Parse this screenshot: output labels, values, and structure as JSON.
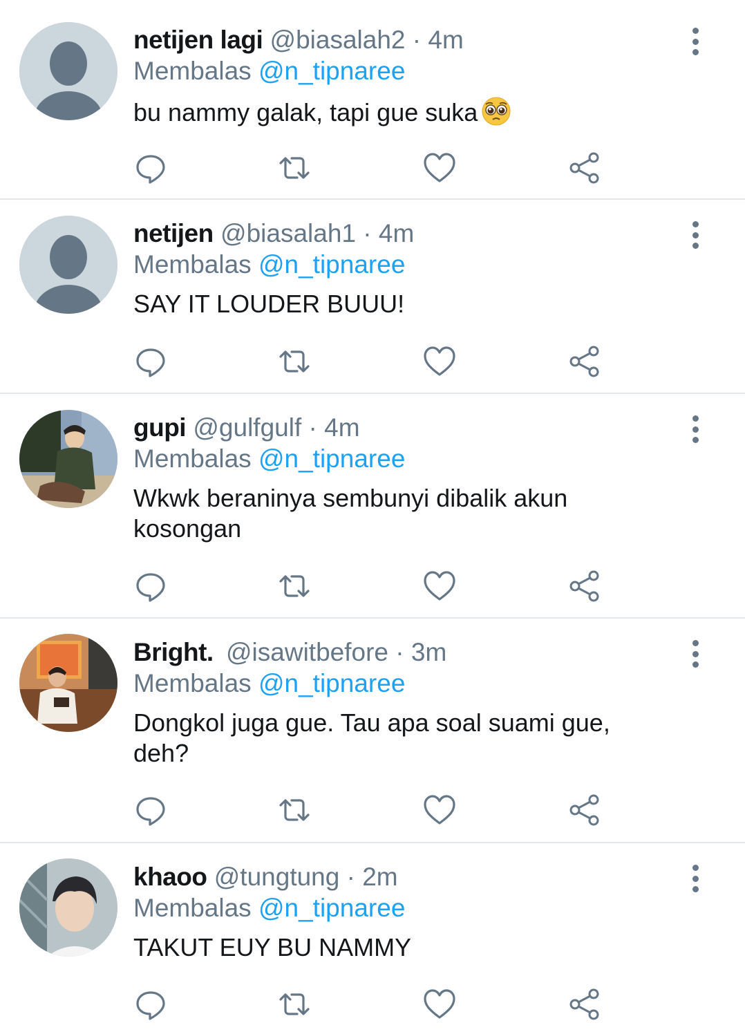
{
  "tweets": [
    {
      "name": "netijen lagi",
      "handle": "@biasalah2",
      "separator": "·",
      "time": "4m",
      "replying_label": "Membalas",
      "replying_to": "@n_tipnaree",
      "text": "bu nammy galak, tapi gue suka",
      "emoji": "pleading-face",
      "avatar": "default-avatar"
    },
    {
      "name": "netijen",
      "handle": "@biasalah1",
      "separator": "·",
      "time": "4m",
      "replying_label": "Membalas",
      "replying_to": "@n_tipnaree",
      "text": "SAY IT LOUDER BUUU!",
      "avatar": "default-avatar"
    },
    {
      "name": "gupi",
      "handle": "@gulfgulf",
      "separator": "·",
      "time": "4m",
      "replying_label": "Membalas",
      "replying_to": "@n_tipnaree",
      "text_line1": "Wkwk beraninya sembunyi dibalik akun",
      "text_line2": "kosongan",
      "avatar": "photo-avatar"
    },
    {
      "name": "Bright.",
      "handle": "@isawitbefore",
      "separator": "·",
      "time": "3m",
      "replying_label": "Membalas",
      "replying_to": "@n_tipnaree",
      "text_line1": "Dongkol juga gue. Tau apa soal suami gue,",
      "text_line2": "deh?",
      "avatar": "photo-avatar"
    },
    {
      "name": "khaoo",
      "handle": "@tungtung",
      "separator": "·",
      "time": "2m",
      "replying_label": "Membalas",
      "replying_to": "@n_tipnaree",
      "text": "TAKUT EUY BU NAMMY",
      "avatar": "photo-avatar"
    }
  ],
  "icons": {
    "reply": "reply-icon",
    "retweet": "retweet-icon",
    "like": "like-icon",
    "share": "share-icon",
    "more": "more-vertical-icon"
  },
  "colors": {
    "text": "#14171a",
    "secondary": "#657786",
    "link": "#1da1f2",
    "divider": "#e3e7ea",
    "avatar_placeholder": "#ccd6dd"
  }
}
